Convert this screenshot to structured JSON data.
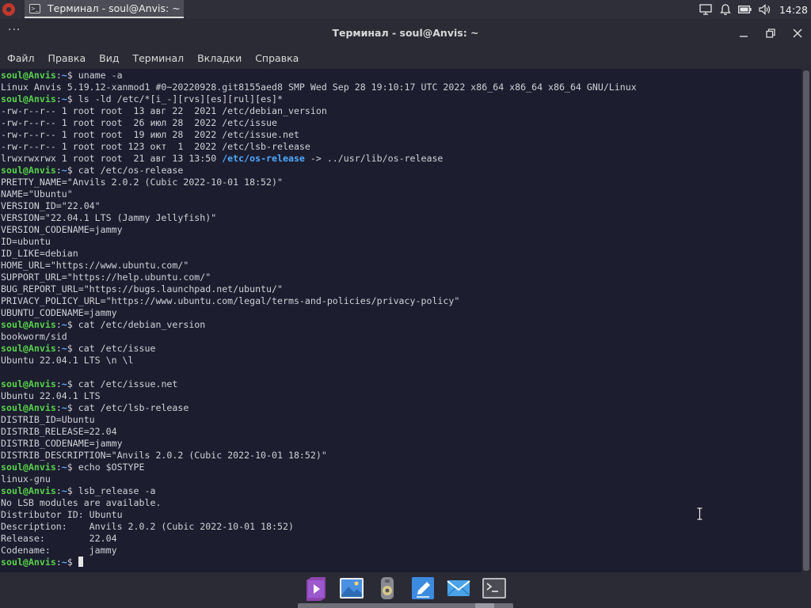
{
  "taskbar": {
    "task_label": "Терминал - soul@Anvis: ~",
    "clock": "14:28"
  },
  "window": {
    "title": "Терминал - soul@Anvis: ~",
    "dots": "···"
  },
  "menu": {
    "items": [
      "Файл",
      "Правка",
      "Вид",
      "Терминал",
      "Вкладки",
      "Справка"
    ]
  },
  "prompt": {
    "user": "soul@Anvis",
    "sep": ":",
    "path": "~",
    "symbol": "$"
  },
  "terminal": {
    "lines": [
      {
        "type": "cmd",
        "text": "uname -a"
      },
      {
        "type": "out",
        "text": "Linux Anvis 5.19.12-xanmod1 #0~20220928.git8155aed8 SMP Wed Sep 28 19:10:17 UTC 2022 x86_64 x86_64 x86_64 GNU/Linux"
      },
      {
        "type": "cmd",
        "text": "ls -ld /etc/*[i_-][rvs][es][rul][es]*"
      },
      {
        "type": "out",
        "text": "-rw-r--r-- 1 root root  13 авг 22  2021 /etc/debian_version"
      },
      {
        "type": "out",
        "text": "-rw-r--r-- 1 root root  26 июл 28  2022 /etc/issue"
      },
      {
        "type": "out",
        "text": "-rw-r--r-- 1 root root  19 июл 28  2022 /etc/issue.net"
      },
      {
        "type": "out",
        "text": "-rw-r--r-- 1 root root 123 окт  1  2022 /etc/lsb-release"
      },
      {
        "type": "link",
        "pre": "lrwxrwxrwx 1 root root  21 авг 13 13:50 ",
        "name": "/etc/os-release",
        "post": " -> ../usr/lib/os-release"
      },
      {
        "type": "cmd",
        "text": "cat /etc/os-release"
      },
      {
        "type": "out",
        "text": "PRETTY_NAME=\"Anvils 2.0.2 (Cubic 2022-10-01 18:52)\""
      },
      {
        "type": "out",
        "text": "NAME=\"Ubuntu\""
      },
      {
        "type": "out",
        "text": "VERSION_ID=\"22.04\""
      },
      {
        "type": "out",
        "text": "VERSION=\"22.04.1 LTS (Jammy Jellyfish)\""
      },
      {
        "type": "out",
        "text": "VERSION_CODENAME=jammy"
      },
      {
        "type": "out",
        "text": "ID=ubuntu"
      },
      {
        "type": "out",
        "text": "ID_LIKE=debian"
      },
      {
        "type": "out",
        "text": "HOME_URL=\"https://www.ubuntu.com/\""
      },
      {
        "type": "out",
        "text": "SUPPORT_URL=\"https://help.ubuntu.com/\""
      },
      {
        "type": "out",
        "text": "BUG_REPORT_URL=\"https://bugs.launchpad.net/ubuntu/\""
      },
      {
        "type": "out",
        "text": "PRIVACY_POLICY_URL=\"https://www.ubuntu.com/legal/terms-and-policies/privacy-policy\""
      },
      {
        "type": "out",
        "text": "UBUNTU_CODENAME=jammy"
      },
      {
        "type": "cmd",
        "text": "cat /etc/debian_version"
      },
      {
        "type": "out",
        "text": "bookworm/sid"
      },
      {
        "type": "cmd",
        "text": "cat /etc/issue"
      },
      {
        "type": "out",
        "text": "Ubuntu 22.04.1 LTS \\n \\l"
      },
      {
        "type": "out",
        "text": ""
      },
      {
        "type": "cmd",
        "text": "cat /etc/issue.net"
      },
      {
        "type": "out",
        "text": "Ubuntu 22.04.1 LTS"
      },
      {
        "type": "cmd",
        "text": "cat /etc/lsb-release"
      },
      {
        "type": "out",
        "text": "DISTRIB_ID=Ubuntu"
      },
      {
        "type": "out",
        "text": "DISTRIB_RELEASE=22.04"
      },
      {
        "type": "out",
        "text": "DISTRIB_CODENAME=jammy"
      },
      {
        "type": "out",
        "text": "DISTRIB_DESCRIPTION=\"Anvils 2.0.2 (Cubic 2022-10-01 18:52)\""
      },
      {
        "type": "cmd",
        "text": "echo $OSTYPE"
      },
      {
        "type": "out",
        "text": "linux-gnu"
      },
      {
        "type": "cmd",
        "text": "lsb_release -a"
      },
      {
        "type": "out",
        "text": "No LSB modules are available."
      },
      {
        "type": "out",
        "text": "Distributor ID:\tUbuntu"
      },
      {
        "type": "out",
        "text": "Description:\tAnvils 2.0.2 (Cubic 2022-10-01 18:52)"
      },
      {
        "type": "out",
        "text": "Release:\t22.04"
      },
      {
        "type": "out",
        "text": "Codename:\tjammy"
      },
      {
        "type": "cmd",
        "text": "",
        "cursor": true
      }
    ]
  },
  "dock": {
    "items": [
      "media-player-icon",
      "image-viewer-icon",
      "disk-icon",
      "text-editor-icon",
      "mail-icon",
      "terminal-icon"
    ]
  },
  "colors": {
    "terminal_bg": "#1c1d2f",
    "prompt_user": "#58d24b",
    "prompt_path": "#5da8ff",
    "text": "#cfd2d6"
  }
}
